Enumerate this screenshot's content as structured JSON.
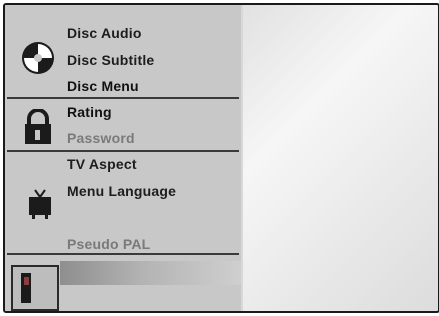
{
  "menu": {
    "disc_group": {
      "icon": "disc-icon",
      "items": [
        {
          "label": "Disc Audio"
        },
        {
          "label": "Disc Subtitle"
        },
        {
          "label": "Disc Menu"
        }
      ]
    },
    "lock_group": {
      "icon": "padlock-icon",
      "items": [
        {
          "label": "Rating"
        },
        {
          "label": "Password"
        }
      ]
    },
    "tv_group": {
      "icon": "tv-icon",
      "items": [
        {
          "label": "TV Aspect"
        },
        {
          "label": "Menu Language"
        },
        {
          "label": "Pseudo PAL"
        }
      ]
    },
    "bottom_icon": "speaker-icon"
  }
}
